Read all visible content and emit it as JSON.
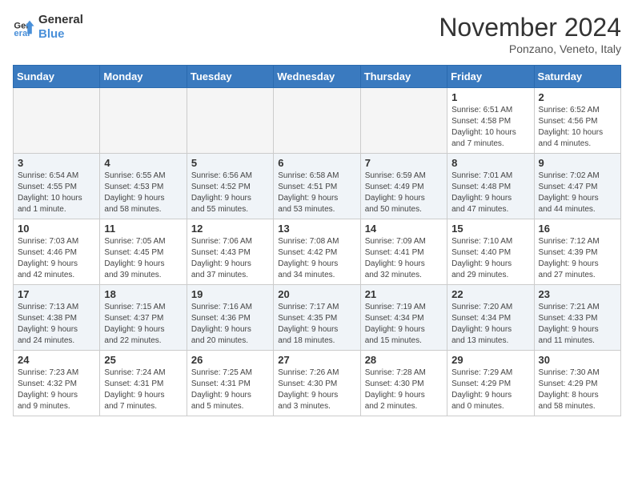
{
  "header": {
    "logo_line1": "General",
    "logo_line2": "Blue",
    "month": "November 2024",
    "location": "Ponzano, Veneto, Italy"
  },
  "days_of_week": [
    "Sunday",
    "Monday",
    "Tuesday",
    "Wednesday",
    "Thursday",
    "Friday",
    "Saturday"
  ],
  "weeks": [
    [
      {
        "day": "",
        "info": ""
      },
      {
        "day": "",
        "info": ""
      },
      {
        "day": "",
        "info": ""
      },
      {
        "day": "",
        "info": ""
      },
      {
        "day": "",
        "info": ""
      },
      {
        "day": "1",
        "info": "Sunrise: 6:51 AM\nSunset: 4:58 PM\nDaylight: 10 hours\nand 7 minutes."
      },
      {
        "day": "2",
        "info": "Sunrise: 6:52 AM\nSunset: 4:56 PM\nDaylight: 10 hours\nand 4 minutes."
      }
    ],
    [
      {
        "day": "3",
        "info": "Sunrise: 6:54 AM\nSunset: 4:55 PM\nDaylight: 10 hours\nand 1 minute."
      },
      {
        "day": "4",
        "info": "Sunrise: 6:55 AM\nSunset: 4:53 PM\nDaylight: 9 hours\nand 58 minutes."
      },
      {
        "day": "5",
        "info": "Sunrise: 6:56 AM\nSunset: 4:52 PM\nDaylight: 9 hours\nand 55 minutes."
      },
      {
        "day": "6",
        "info": "Sunrise: 6:58 AM\nSunset: 4:51 PM\nDaylight: 9 hours\nand 53 minutes."
      },
      {
        "day": "7",
        "info": "Sunrise: 6:59 AM\nSunset: 4:49 PM\nDaylight: 9 hours\nand 50 minutes."
      },
      {
        "day": "8",
        "info": "Sunrise: 7:01 AM\nSunset: 4:48 PM\nDaylight: 9 hours\nand 47 minutes."
      },
      {
        "day": "9",
        "info": "Sunrise: 7:02 AM\nSunset: 4:47 PM\nDaylight: 9 hours\nand 44 minutes."
      }
    ],
    [
      {
        "day": "10",
        "info": "Sunrise: 7:03 AM\nSunset: 4:46 PM\nDaylight: 9 hours\nand 42 minutes."
      },
      {
        "day": "11",
        "info": "Sunrise: 7:05 AM\nSunset: 4:45 PM\nDaylight: 9 hours\nand 39 minutes."
      },
      {
        "day": "12",
        "info": "Sunrise: 7:06 AM\nSunset: 4:43 PM\nDaylight: 9 hours\nand 37 minutes."
      },
      {
        "day": "13",
        "info": "Sunrise: 7:08 AM\nSunset: 4:42 PM\nDaylight: 9 hours\nand 34 minutes."
      },
      {
        "day": "14",
        "info": "Sunrise: 7:09 AM\nSunset: 4:41 PM\nDaylight: 9 hours\nand 32 minutes."
      },
      {
        "day": "15",
        "info": "Sunrise: 7:10 AM\nSunset: 4:40 PM\nDaylight: 9 hours\nand 29 minutes."
      },
      {
        "day": "16",
        "info": "Sunrise: 7:12 AM\nSunset: 4:39 PM\nDaylight: 9 hours\nand 27 minutes."
      }
    ],
    [
      {
        "day": "17",
        "info": "Sunrise: 7:13 AM\nSunset: 4:38 PM\nDaylight: 9 hours\nand 24 minutes."
      },
      {
        "day": "18",
        "info": "Sunrise: 7:15 AM\nSunset: 4:37 PM\nDaylight: 9 hours\nand 22 minutes."
      },
      {
        "day": "19",
        "info": "Sunrise: 7:16 AM\nSunset: 4:36 PM\nDaylight: 9 hours\nand 20 minutes."
      },
      {
        "day": "20",
        "info": "Sunrise: 7:17 AM\nSunset: 4:35 PM\nDaylight: 9 hours\nand 18 minutes."
      },
      {
        "day": "21",
        "info": "Sunrise: 7:19 AM\nSunset: 4:34 PM\nDaylight: 9 hours\nand 15 minutes."
      },
      {
        "day": "22",
        "info": "Sunrise: 7:20 AM\nSunset: 4:34 PM\nDaylight: 9 hours\nand 13 minutes."
      },
      {
        "day": "23",
        "info": "Sunrise: 7:21 AM\nSunset: 4:33 PM\nDaylight: 9 hours\nand 11 minutes."
      }
    ],
    [
      {
        "day": "24",
        "info": "Sunrise: 7:23 AM\nSunset: 4:32 PM\nDaylight: 9 hours\nand 9 minutes."
      },
      {
        "day": "25",
        "info": "Sunrise: 7:24 AM\nSunset: 4:31 PM\nDaylight: 9 hours\nand 7 minutes."
      },
      {
        "day": "26",
        "info": "Sunrise: 7:25 AM\nSunset: 4:31 PM\nDaylight: 9 hours\nand 5 minutes."
      },
      {
        "day": "27",
        "info": "Sunrise: 7:26 AM\nSunset: 4:30 PM\nDaylight: 9 hours\nand 3 minutes."
      },
      {
        "day": "28",
        "info": "Sunrise: 7:28 AM\nSunset: 4:30 PM\nDaylight: 9 hours\nand 2 minutes."
      },
      {
        "day": "29",
        "info": "Sunrise: 7:29 AM\nSunset: 4:29 PM\nDaylight: 9 hours\nand 0 minutes."
      },
      {
        "day": "30",
        "info": "Sunrise: 7:30 AM\nSunset: 4:29 PM\nDaylight: 8 hours\nand 58 minutes."
      }
    ]
  ]
}
